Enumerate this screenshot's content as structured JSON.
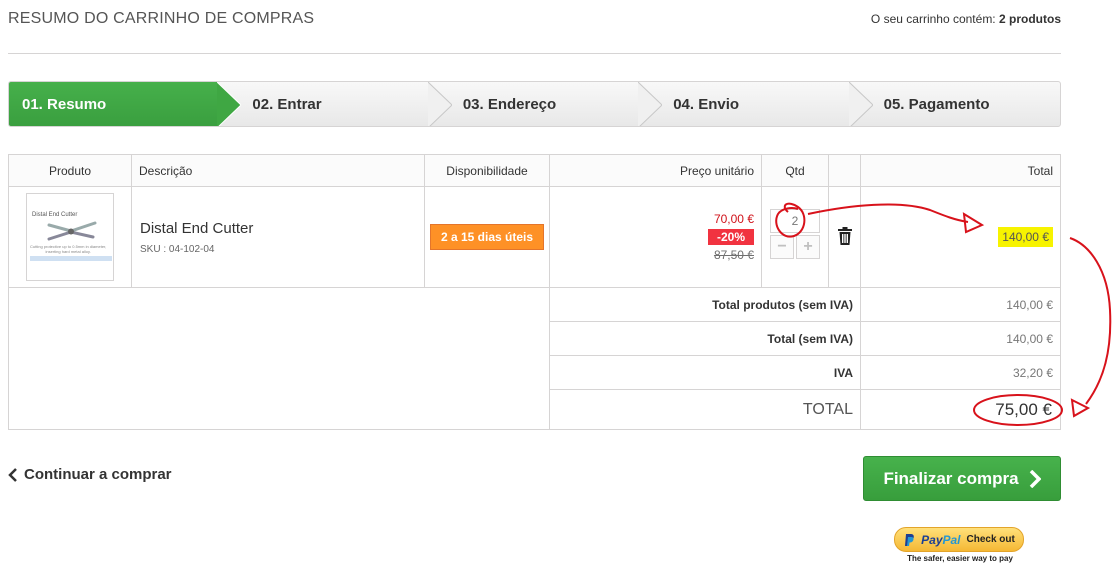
{
  "header": {
    "title": "RESUMO DO CARRINHO DE COMPRAS",
    "cart_prefix": "O seu carrinho contém:",
    "cart_count": "2 produtos"
  },
  "steps": [
    {
      "label": "01. Resumo",
      "active": true
    },
    {
      "label": "02. Entrar",
      "active": false
    },
    {
      "label": "03. Endereço",
      "active": false
    },
    {
      "label": "04. Envio",
      "active": false
    },
    {
      "label": "05. Pagamento",
      "active": false
    }
  ],
  "table": {
    "headers": {
      "product": "Produto",
      "description": "Descrição",
      "availability": "Disponibilidade",
      "unit_price": "Preço unitário",
      "qty": "Qtd",
      "total": "Total"
    },
    "item": {
      "thumb_title": "Distal End Cutter",
      "thumb_text_1": "Cutting protective up to 0.5mm in diameter,",
      "thumb_text_2": "inserting hard metal alloy.",
      "name": "Distal End Cutter",
      "sku": "SKU : 04-102-04",
      "availability": "2 a 15 dias úteis",
      "price_new": "70,00 €",
      "discount": "-20%",
      "price_old": "87,50 €",
      "qty": "2",
      "total": "140,00 €"
    },
    "summary": [
      {
        "label": "Total produtos (sem IVA)",
        "value": "140,00 €"
      },
      {
        "label": "Total (sem IVA)",
        "value": "140,00 €"
      },
      {
        "label": "IVA",
        "value": "32,20 €"
      }
    ],
    "grand_total": {
      "label": "TOTAL",
      "value": "75,00 €"
    }
  },
  "actions": {
    "continue": "Continuar a comprar",
    "finalize": "Finalizar compra"
  },
  "paypal": {
    "logo_a": "Pay",
    "logo_b": "Pal",
    "cta": "Check out",
    "tagline": "The safer, easier way to pay"
  },
  "colors": {
    "accent_green": "#46b04b",
    "availability_orange": "#fe9126",
    "discount_red": "#f13340",
    "highlight_yellow": "#f7f300",
    "annotation_red": "#d8121b"
  },
  "icons": [
    "chevron-left-icon",
    "chevron-right-icon",
    "trash-icon",
    "minus-icon",
    "plus-icon",
    "paypal-logo-icon"
  ]
}
